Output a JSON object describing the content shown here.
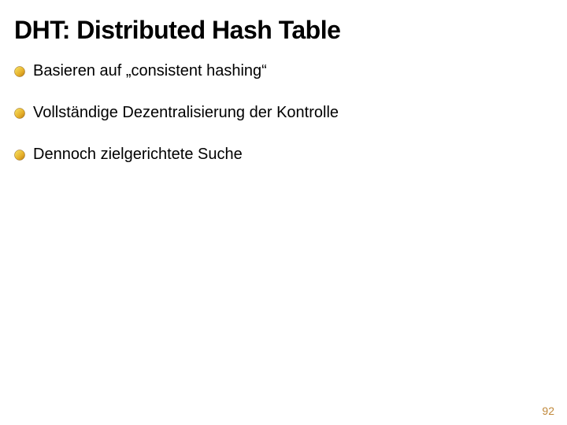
{
  "slide": {
    "title": "DHT: Distributed Hash Table",
    "bullets": [
      {
        "text": "Basieren auf „consistent hashing“"
      },
      {
        "text": "Vollständige Dezentralisierung der Kontrolle"
      },
      {
        "text": "Dennoch zielgerichtete Suche"
      }
    ],
    "page_number": "92"
  }
}
